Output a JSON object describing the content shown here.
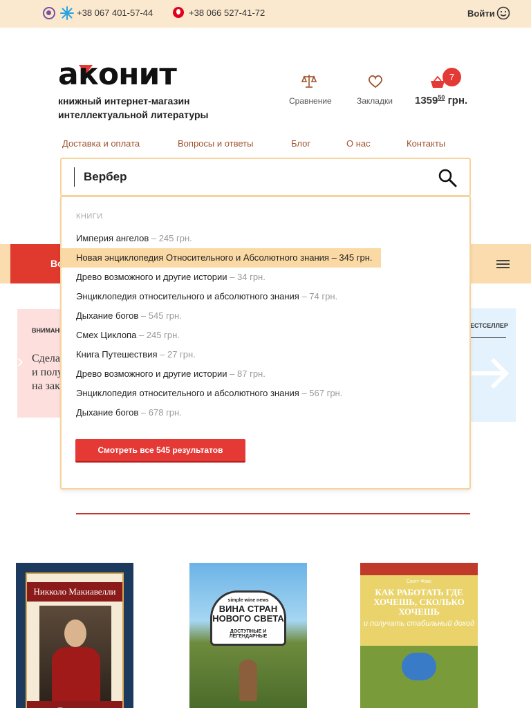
{
  "topbar": {
    "phone1": "+38 067 401-57-44",
    "phone2": "+38 066 527-41-72",
    "login": "Войти",
    "icons": [
      "viber-icon",
      "kyivstar-icon",
      "vodafone-icon",
      "smile-icon"
    ]
  },
  "header": {
    "logo_text": "аконит",
    "tagline_line1": "книжный интернет-магазин",
    "tagline_line2": "интеллектуальной литературы",
    "compare_label": "Сравнение",
    "bookmarks_label": "Закладки",
    "cart_count": "7",
    "cart_price_main": "1359",
    "cart_price_cents": "50",
    "cart_price_currency": "грн."
  },
  "nav": {
    "items": [
      "Доставка и оплата",
      "Вопросы и ответы",
      "Блог",
      "О нас",
      "Контакты"
    ]
  },
  "search": {
    "value": "Вербер",
    "section_label": "КНИГИ",
    "results": [
      {
        "title": "Империя ангелов",
        "price": "– 245 грн."
      },
      {
        "title": "Новая энциклопедия Относительного и Абсолютного знания",
        "price": "– 345 грн.",
        "highlighted": true
      },
      {
        "title": "Древо возможного и другие истории",
        "price": "– 34 грн."
      },
      {
        "title": "Энциклопедия относительного и абсолютного знания",
        "price": "– 74 грн."
      },
      {
        "title": "Дыхание богов",
        "price": "– 545 грн."
      },
      {
        "title": "Смех Циклопа",
        "price": "– 245 грн."
      },
      {
        "title": "Книга Путешествия",
        "price": "– 27 грн."
      },
      {
        "title": "Древо возможного и другие истории",
        "price": "– 87 грн."
      },
      {
        "title": "Энциклопедия относительного и абсолютного знания",
        "price": "– 567 грн."
      },
      {
        "title": "Дыхание богов",
        "price": "– 678 грн."
      }
    ],
    "show_all": "Смотреть все 545 результатов"
  },
  "background": {
    "banner_label": "Во",
    "promo_left_tag": "ВНИМАНИ",
    "promo_left_text": [
      "Сдела",
      "и полу",
      "на зак"
    ],
    "promo_right_tag": "ЕСТСЕЛЛЕР"
  },
  "books": [
    {
      "author": "Никколо Макиавелли",
      "title": "Государь"
    },
    {
      "series": "simple wine news",
      "title": "ВИНА СТРАН НОВОГО СВЕТА",
      "subtitle": "ДОСТУПНЫЕ И ЛЕГЕНДАРНЫЕ"
    },
    {
      "author": "Скотт Фокс",
      "title": "КАК РАБОТАТЬ ГДЕ ХОЧЕШЬ, СКОЛЬКО ХОЧЕШЬ",
      "subtitle": "и получать стабильный доход"
    }
  ],
  "colors": {
    "topbar_bg": "#fbe9cf",
    "accent_red": "#e53935",
    "nav_link": "#a0522d",
    "highlight": "#fbd9a4",
    "search_border": "#f7d39b"
  }
}
